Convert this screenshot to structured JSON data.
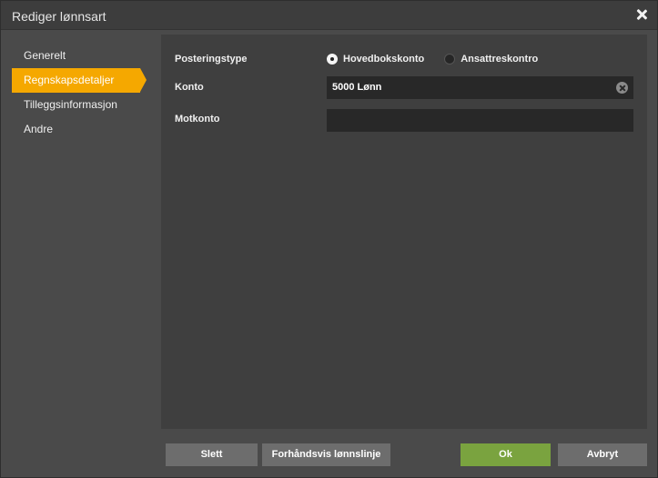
{
  "dialog": {
    "title": "Rediger lønnsart"
  },
  "sidebar": {
    "items": [
      {
        "label": "Generelt"
      },
      {
        "label": "Regnskapsdetaljer",
        "active": true
      },
      {
        "label": "Tilleggsinformasjon"
      },
      {
        "label": "Andre"
      }
    ]
  },
  "form": {
    "posteringstype": {
      "label": "Posteringstype",
      "options": [
        {
          "label": "Hovedbokskonto",
          "checked": true
        },
        {
          "label": "Ansattreskontro",
          "checked": false
        }
      ]
    },
    "konto": {
      "label": "Konto",
      "value": "5000 Lønn"
    },
    "motkonto": {
      "label": "Motkonto",
      "value": ""
    }
  },
  "footer": {
    "delete_label": "Slett",
    "preview_label": "Forhåndsvis lønnslinje",
    "ok_label": "Ok",
    "cancel_label": "Avbryt"
  },
  "colors": {
    "accent": "#f5a800",
    "ok_button": "#7aa33f"
  }
}
